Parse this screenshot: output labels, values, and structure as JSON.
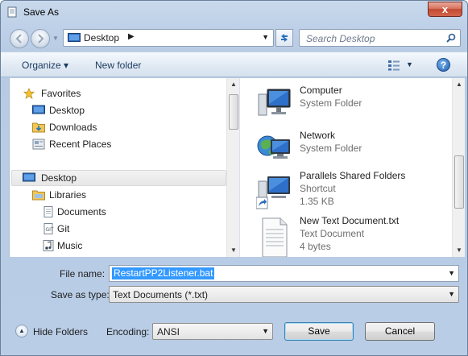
{
  "window": {
    "title": "Save As",
    "close_glyph": "x"
  },
  "address_bar": {
    "location": "Desktop",
    "separator": "▶",
    "dropdown": "▼"
  },
  "search": {
    "placeholder": "Search Desktop"
  },
  "toolbar": {
    "organize": "Organize ▾",
    "new_folder": "New folder",
    "views_dropdown": "▼",
    "help": "?"
  },
  "nav_tree": {
    "items": [
      {
        "label": "Favorites",
        "icon": "star-icon"
      },
      {
        "label": "Desktop",
        "icon": "desktop-icon"
      },
      {
        "label": "Downloads",
        "icon": "downloads-folder-icon"
      },
      {
        "label": "Recent Places",
        "icon": "recent-places-icon"
      },
      {
        "label": "Desktop",
        "icon": "desktop-icon",
        "selected": true
      },
      {
        "label": "Libraries",
        "icon": "libraries-icon"
      },
      {
        "label": "Documents",
        "icon": "documents-icon"
      },
      {
        "label": "Git",
        "icon": "git-icon"
      },
      {
        "label": "Music",
        "icon": "music-icon"
      }
    ]
  },
  "files": [
    {
      "name": "Computer",
      "lines": [
        "System Folder"
      ],
      "icon": "computer-icon"
    },
    {
      "name": "Network",
      "lines": [
        "System Folder"
      ],
      "icon": "network-icon"
    },
    {
      "name": "Parallels Shared Folders",
      "lines": [
        "Shortcut",
        "1.35 KB"
      ],
      "icon": "shortcut-folder-icon"
    },
    {
      "name": "New Text Document.txt",
      "lines": [
        "Text Document",
        "4 bytes"
      ],
      "icon": "text-document-icon"
    }
  ],
  "form": {
    "file_name_label": "File name:",
    "file_name_value": "RestartPP2Listener.bat",
    "save_type_label": "Save as type:",
    "save_type_value": "Text Documents (*.txt)",
    "hide_folders_label": "Hide Folders",
    "encoding_label": "Encoding:",
    "encoding_value": "ANSI",
    "save_label": "Save",
    "cancel_label": "Cancel",
    "combo_arrow": "▼",
    "hide_arrow": "▲"
  },
  "colors": {
    "selection": "#3399ff",
    "chrome": "#bfd1e8",
    "accent": "#1c3a5e"
  }
}
